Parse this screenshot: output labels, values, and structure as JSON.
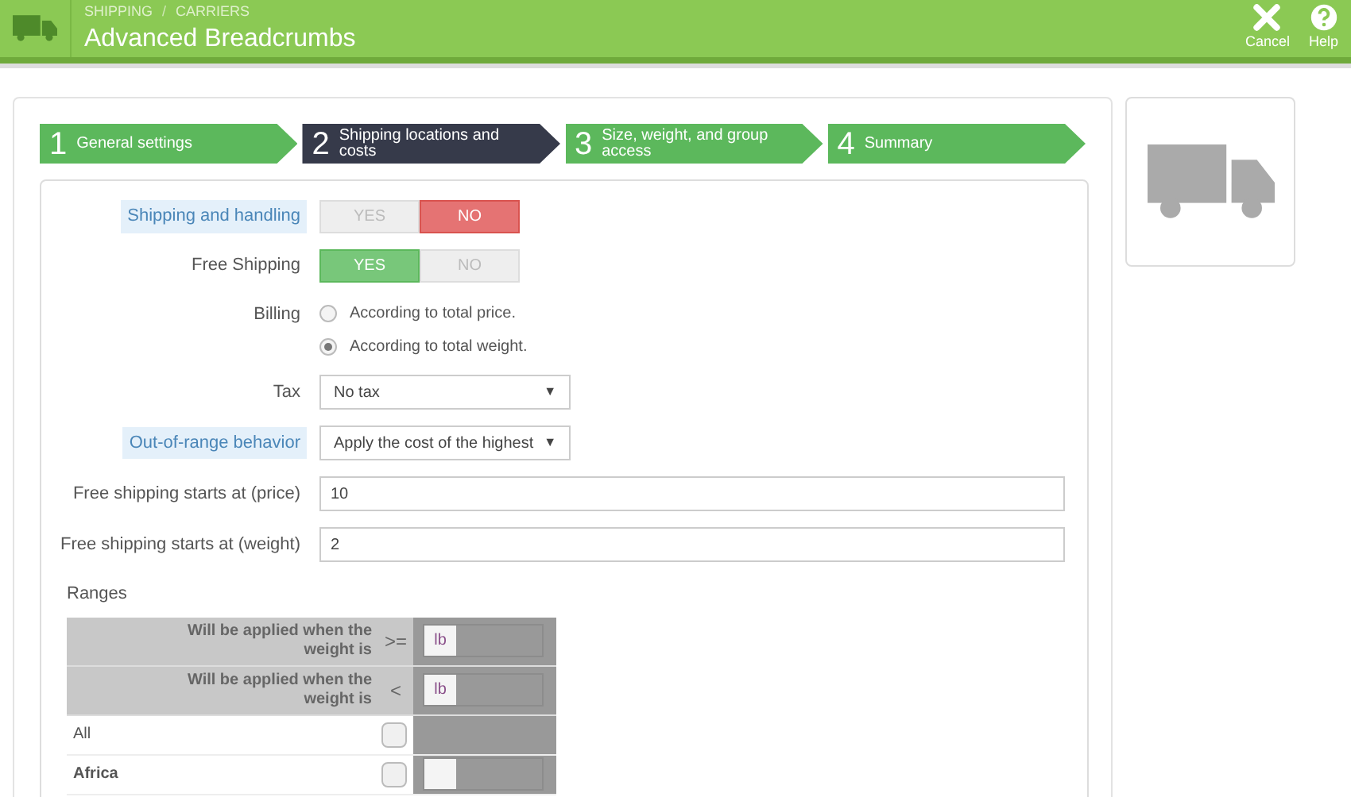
{
  "header": {
    "breadcrumb": [
      "SHIPPING",
      "CARRIERS"
    ],
    "separator": "/",
    "title": "Advanced Breadcrumbs",
    "actions": [
      {
        "kind": "cancel",
        "label": "Cancel"
      },
      {
        "kind": "help",
        "label": "Help"
      }
    ]
  },
  "steps": [
    {
      "number": "1",
      "label": "General settings",
      "selected": false
    },
    {
      "number": "2",
      "label": "Shipping locations and costs",
      "selected": true
    },
    {
      "number": "3",
      "label": "Size, weight, and group access",
      "selected": false
    },
    {
      "number": "4",
      "label": "Summary",
      "selected": false
    }
  ],
  "form": [
    {
      "kind": "toggle",
      "label": "Shipping and handling",
      "highlighted": true,
      "options": [
        {
          "label": "YES",
          "selected": false
        },
        {
          "label": "NO",
          "selected": true
        }
      ]
    },
    {
      "kind": "toggle",
      "label": "Free Shipping",
      "highlighted": false,
      "options": [
        {
          "label": "YES",
          "selected": true
        },
        {
          "label": "NO",
          "selected": false
        }
      ]
    },
    {
      "kind": "radio",
      "label": "Billing",
      "highlighted": false,
      "options": [
        {
          "label": "According to total price.",
          "selected": false
        },
        {
          "label": "According to total weight.",
          "selected": true
        }
      ]
    },
    {
      "kind": "select",
      "label": "Tax",
      "highlighted": false,
      "value": "No tax",
      "arrow": "▼"
    },
    {
      "kind": "select",
      "label": "Out-of-range behavior",
      "highlighted": true,
      "value": "Apply the cost of the highest",
      "arrow": "▼"
    },
    {
      "kind": "text",
      "label": "Free shipping starts at (price)",
      "highlighted": false,
      "value": "10"
    },
    {
      "kind": "text",
      "label": "Free shipping starts at (weight)",
      "highlighted": false,
      "value": "2"
    }
  ],
  "ranges": {
    "title": "Ranges",
    "header_rows": [
      {
        "label": "Will be applied when the weight is",
        "operator": ">=",
        "unit": "lb"
      },
      {
        "label": "Will be applied when the weight is",
        "operator": "<",
        "unit": "lb"
      }
    ],
    "rows": [
      {
        "kind": "all",
        "name": "All",
        "checked": false
      },
      {
        "kind": "zone",
        "name": "Africa",
        "checked": false
      }
    ]
  }
}
